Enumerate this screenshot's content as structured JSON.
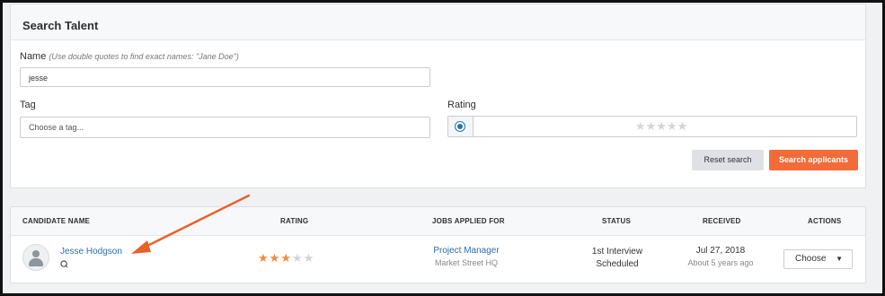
{
  "search": {
    "title": "Search Talent",
    "name_label": "Name",
    "name_hint": "(Use double quotes to find exact names: \"Jane Doe\")",
    "name_value": "jesse",
    "tag_label": "Tag",
    "tag_placeholder": "Choose a tag...",
    "rating_label": "Rating",
    "rating_stars": "★★★★★",
    "reset_label": "Reset search",
    "search_label": "Search applicants"
  },
  "table": {
    "headers": {
      "candidate": "CANDIDATE NAME",
      "rating": "RATING",
      "jobs": "JOBS APPLIED FOR",
      "status": "STATUS",
      "received": "RECEIVED",
      "actions": "ACTIONS"
    },
    "rows": [
      {
        "name": "Jesse Hodgson",
        "rating": 3,
        "rating_max": 5,
        "job_title": "Project Manager",
        "job_location": "Market Street HQ",
        "status_line1": "1st Interview",
        "status_line2": "Scheduled",
        "received_date": "Jul 27, 2018",
        "received_ago": "About 5 years ago",
        "action_label": "Choose"
      }
    ]
  },
  "colors": {
    "accent_orange": "#f26b38",
    "link_blue": "#2a6fb0",
    "star_on": "#f08c3a",
    "arrow": "#e8622a"
  },
  "icons": [
    "radio-icon",
    "star-icon",
    "avatar-icon",
    "chat-icon",
    "caret-down-icon",
    "arrow-annotation"
  ]
}
